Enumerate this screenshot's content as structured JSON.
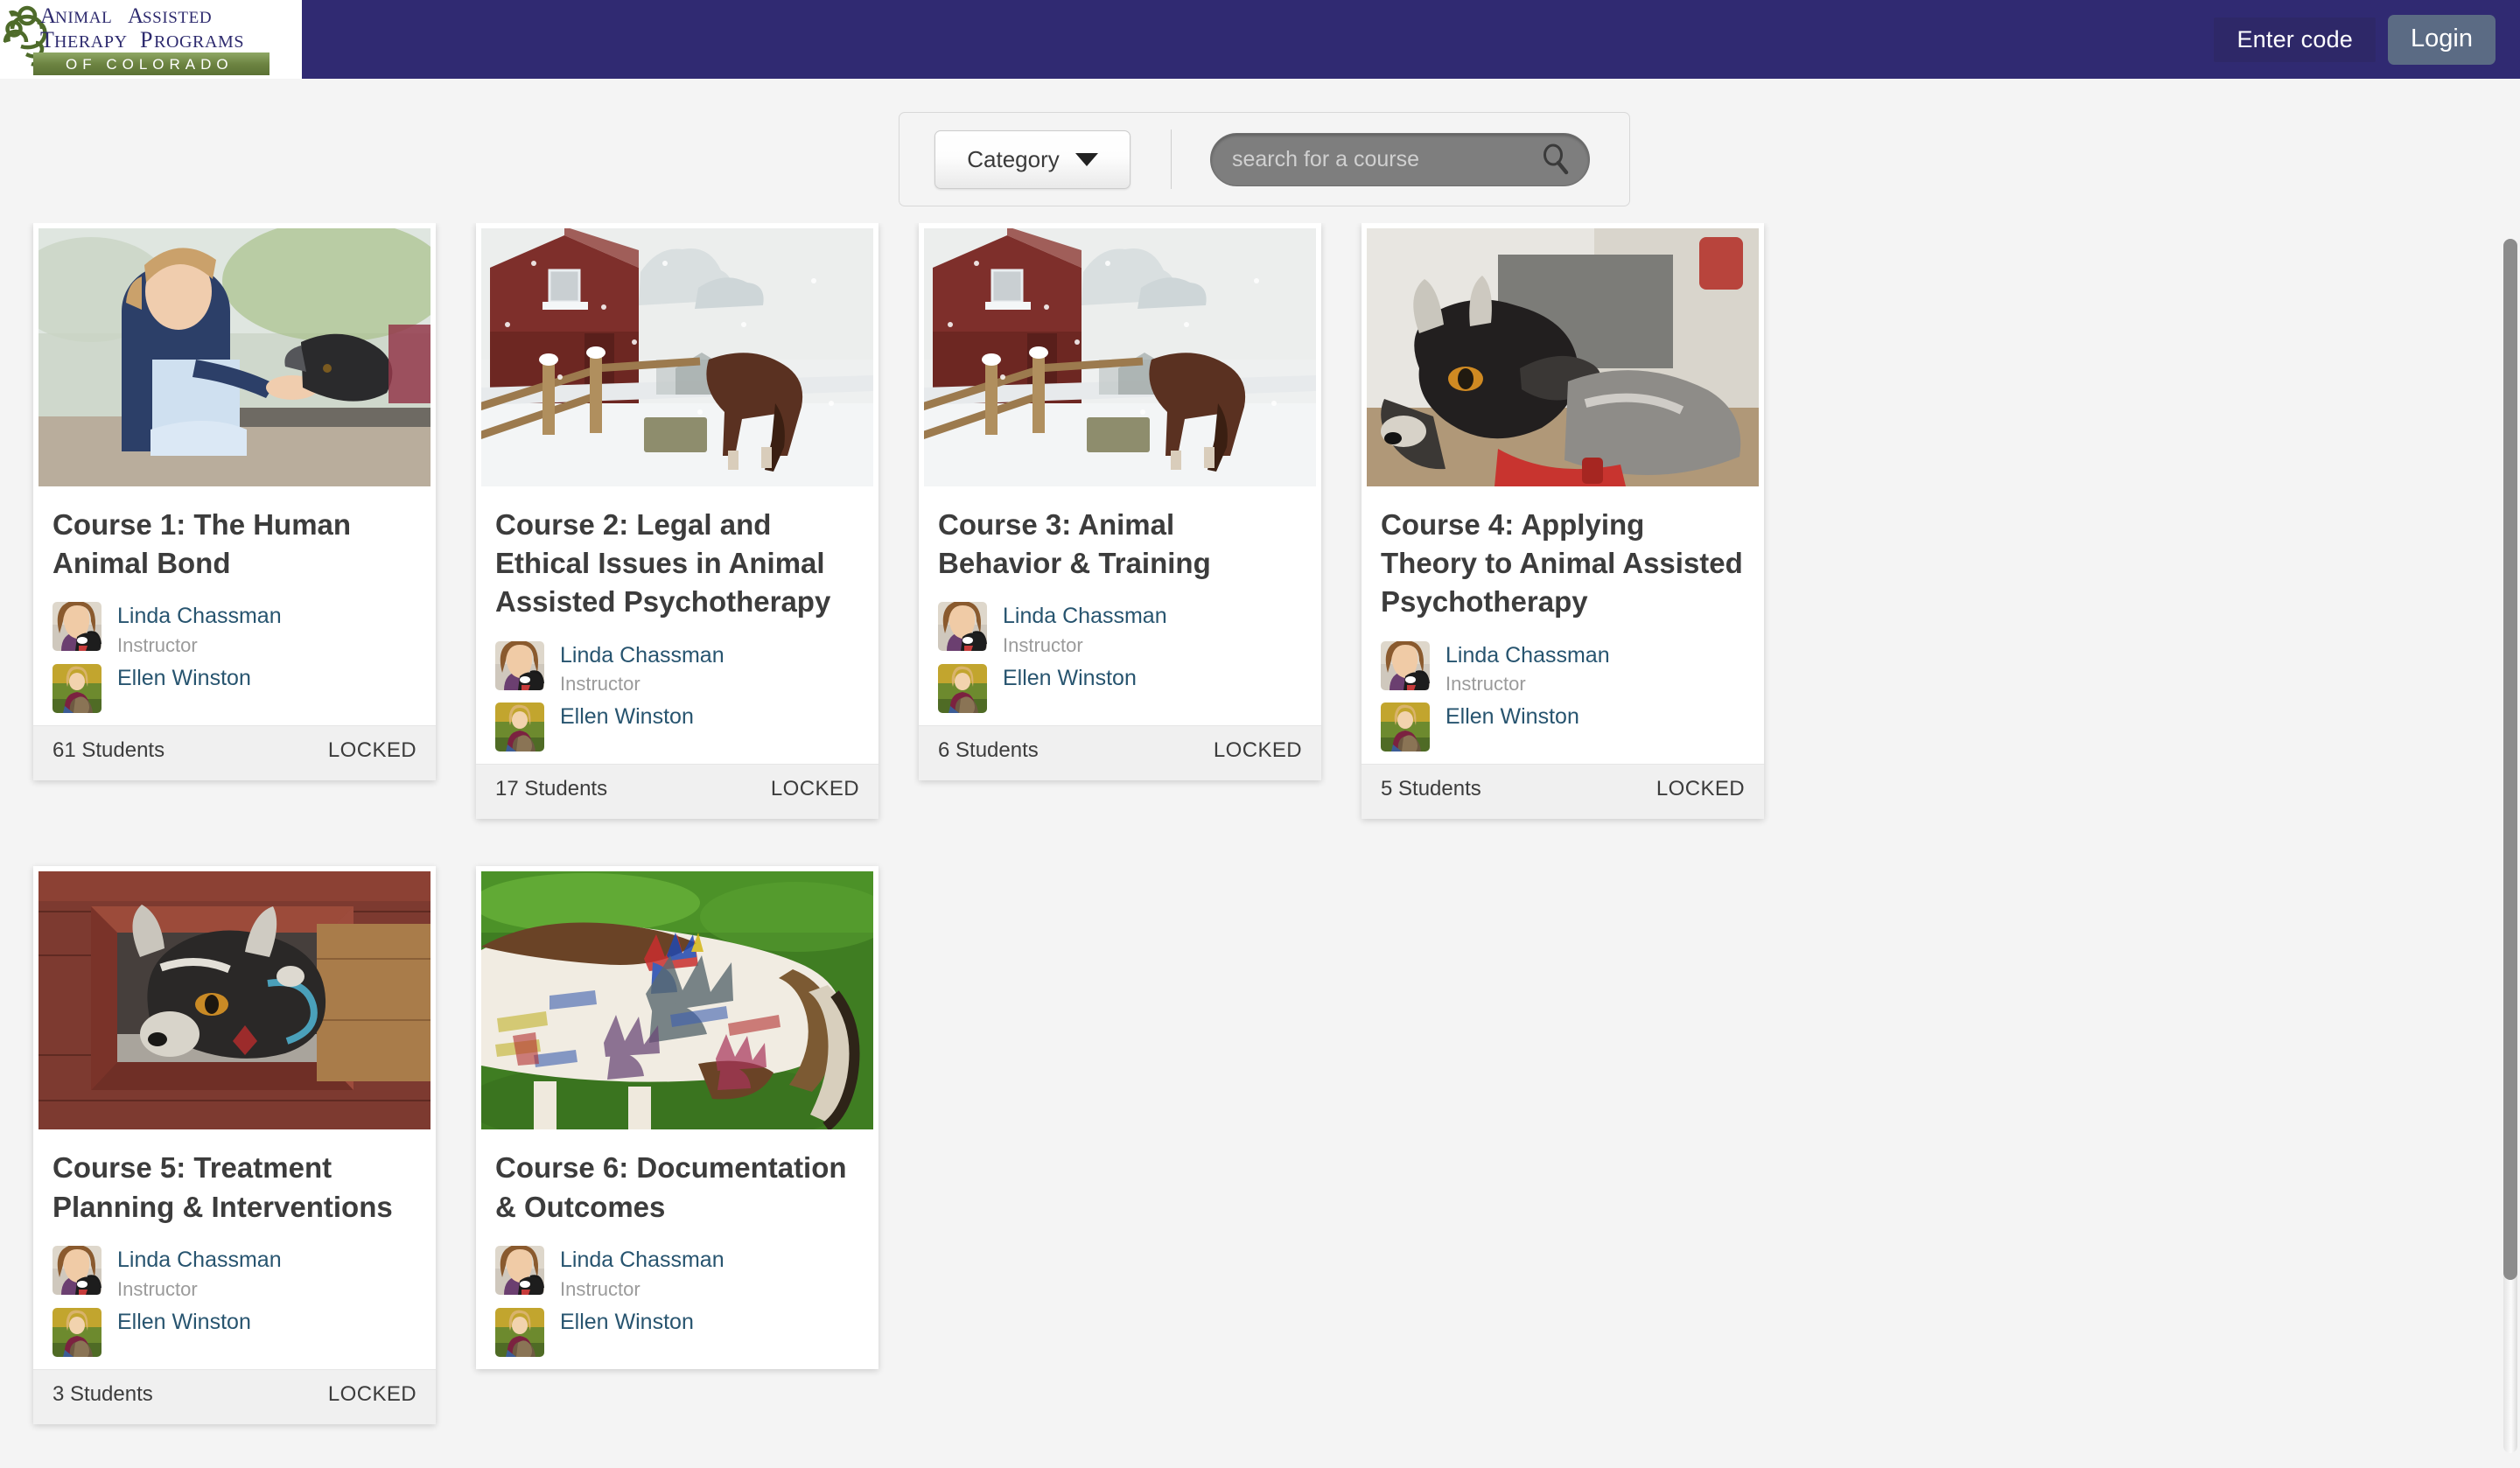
{
  "header": {
    "logo": {
      "line1": "ANIMAL ASSISTED",
      "line2": "THERAPY PROGRAMS",
      "line3": "OF COLORADO"
    },
    "enter_code_label": "Enter code",
    "login_label": "Login",
    "bar_color": "#302a72",
    "login_button_color": "#5b6b84"
  },
  "search": {
    "category_label": "Category",
    "category_icon": "chevron-down-icon",
    "search_placeholder": "search for a course",
    "search_value": "",
    "search_icon": "magnifier-icon"
  },
  "courses": [
    {
      "title": "Course 1: The Human Animal Bond",
      "thumb_alt": "girl-feeding-small-black-animal",
      "instructors": [
        {
          "name": "Linda Chassman",
          "role": "Instructor",
          "avatar_alt": "linda-chassman-avatar"
        },
        {
          "name": "Ellen Winston",
          "role": "",
          "avatar_alt": "ellen-winston-avatar"
        }
      ],
      "students": "61 Students",
      "status": "LOCKED"
    },
    {
      "title": "Course 2: Legal and Ethical Issues in Animal Assisted Psychotherapy",
      "thumb_alt": "red-barn-horse-in-snow",
      "instructors": [
        {
          "name": "Linda Chassman",
          "role": "Instructor",
          "avatar_alt": "linda-chassman-avatar"
        },
        {
          "name": "Ellen Winston",
          "role": "",
          "avatar_alt": "ellen-winston-avatar"
        }
      ],
      "students": "17 Students",
      "status": "LOCKED"
    },
    {
      "title": "Course 3: Animal Behavior & Training",
      "thumb_alt": "red-barn-horse-in-snow",
      "instructors": [
        {
          "name": "Linda Chassman",
          "role": "Instructor",
          "avatar_alt": "linda-chassman-avatar"
        },
        {
          "name": "Ellen Winston",
          "role": "",
          "avatar_alt": "ellen-winston-avatar"
        }
      ],
      "students": "6 Students",
      "status": "LOCKED"
    },
    {
      "title": "Course 4: Applying Theory to Animal Assisted Psychotherapy",
      "thumb_alt": "black-and-grey-goat-head",
      "instructors": [
        {
          "name": "Linda Chassman",
          "role": "Instructor",
          "avatar_alt": "linda-chassman-avatar"
        },
        {
          "name": "Ellen Winston",
          "role": "",
          "avatar_alt": "ellen-winston-avatar"
        }
      ],
      "students": "5 Students",
      "status": "LOCKED"
    },
    {
      "title": "Course 5: Treatment Planning & Interventions",
      "thumb_alt": "goat-in-red-barn-window",
      "instructors": [
        {
          "name": "Linda Chassman",
          "role": "Instructor",
          "avatar_alt": "linda-chassman-avatar"
        },
        {
          "name": "Ellen Winston",
          "role": "",
          "avatar_alt": "ellen-winston-avatar"
        }
      ],
      "students": "3 Students",
      "status": "LOCKED"
    },
    {
      "title": "Course 6: Documentation & Outcomes",
      "thumb_alt": "horse-painted-with-handprints-on-grass",
      "instructors": [
        {
          "name": "Linda Chassman",
          "role": "Instructor",
          "avatar_alt": "linda-chassman-avatar"
        },
        {
          "name": "Ellen Winston",
          "role": "",
          "avatar_alt": "ellen-winston-avatar"
        }
      ],
      "students": "",
      "status": ""
    }
  ]
}
